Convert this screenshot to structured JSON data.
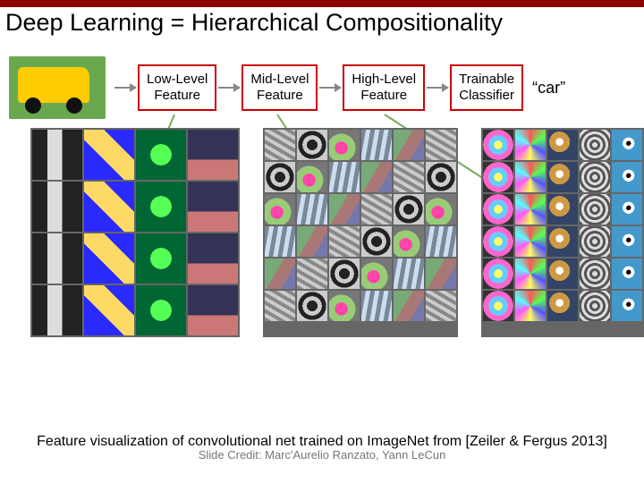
{
  "title": "Deep Learning = Hierarchical Compositionality",
  "pipeline": {
    "stages": [
      {
        "label_line1": "Low-Level",
        "label_line2": "Feature"
      },
      {
        "label_line1": "Mid-Level",
        "label_line2": "Feature"
      },
      {
        "label_line1": "High-Level",
        "label_line2": "Feature"
      },
      {
        "label_line1": "Trainable",
        "label_line2": "Classifier"
      }
    ],
    "output_label": "“car”"
  },
  "caption_main": "Feature visualization of convolutional net trained on ImageNet from [Zeiler & Fergus 2013]",
  "caption_sub": "Slide Credit: Marc'Aurelio Ranzato, Yann LeCun",
  "colors": {
    "accent": "#8a0000",
    "box_border": "#c00000"
  }
}
